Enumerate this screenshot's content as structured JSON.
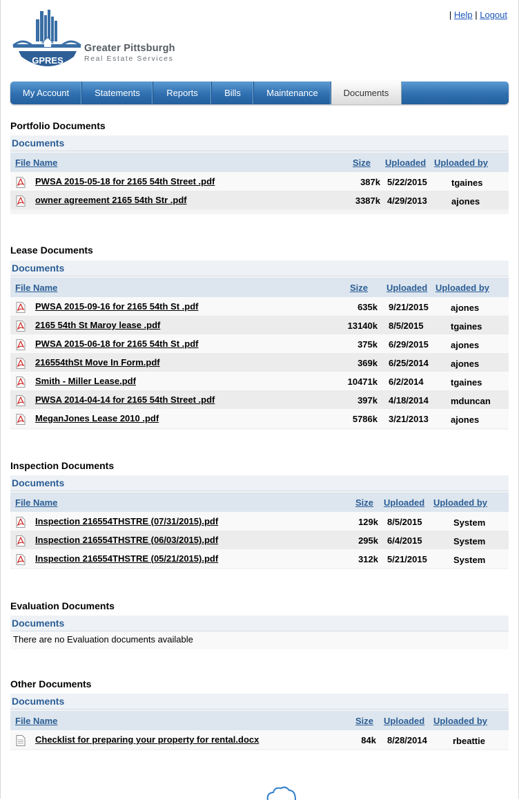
{
  "header": {
    "top_links": {
      "sep1": "|",
      "help": "Help",
      "sep2": "|",
      "logout": "Logout"
    },
    "logo": {
      "badge": "GPRES",
      "name": "Greater Pittsburgh",
      "tagline": "Real Estate Services"
    }
  },
  "nav": {
    "tabs": [
      {
        "label": "My Account",
        "active": false
      },
      {
        "label": "Statements",
        "active": false
      },
      {
        "label": "Reports",
        "active": false
      },
      {
        "label": "Bills",
        "active": false
      },
      {
        "label": "Maintenance",
        "active": false
      },
      {
        "label": "Documents",
        "active": true
      }
    ]
  },
  "columns": {
    "file_name": "File Name",
    "size": "Size",
    "uploaded": "Uploaded",
    "uploaded_by": "Uploaded by"
  },
  "sections": {
    "portfolio": {
      "title": "Portfolio Documents",
      "panel_title": "Documents",
      "files": [
        {
          "name": "PWSA 2015-05-18 for  2165 54th Street .pdf",
          "size": "387k",
          "uploaded": "5/22/2015",
          "by": "tgaines",
          "type": "pdf"
        },
        {
          "name": "owner agreement 2165 54th Str   .pdf",
          "size": "3387k",
          "uploaded": "4/29/2013",
          "by": "ajones",
          "type": "pdf"
        }
      ]
    },
    "lease": {
      "title": "Lease Documents",
      "panel_title": "Documents",
      "files": [
        {
          "name": "PWSA 2015-09-16 for  2165 54th St           .pdf",
          "size": "635k",
          "uploaded": "9/21/2015",
          "by": "ajones",
          "type": "pdf"
        },
        {
          "name": "2165 54th St Maroy lease .pdf",
          "size": "13140k",
          "uploaded": "8/5/2015",
          "by": "tgaines",
          "type": "pdf"
        },
        {
          "name": "PWSA 2015-06-18 for  2165 54th St           .pdf",
          "size": "375k",
          "uploaded": "6/29/2015",
          "by": "ajones",
          "type": "pdf"
        },
        {
          "name": "216554thSt Move In Form.pdf",
          "size": "369k",
          "uploaded": "6/25/2014",
          "by": "ajones",
          "type": "pdf"
        },
        {
          "name": "Smith - Miller Lease.pdf",
          "size": "10471k",
          "uploaded": "6/2/2014",
          "by": "tgaines",
          "type": "pdf"
        },
        {
          "name": "PWSA 2014-04-14 for  2165 54th Street .pdf",
          "size": "397k",
          "uploaded": "4/18/2014",
          "by": "mduncan",
          "type": "pdf"
        },
        {
          "name": "MeganJones Lease 2010 .pdf",
          "size": "5786k",
          "uploaded": "3/21/2013",
          "by": "ajones",
          "type": "pdf"
        }
      ]
    },
    "inspection": {
      "title": "Inspection Documents",
      "panel_title": "Documents",
      "files": [
        {
          "name": "Inspection  216554THSTRE (07/31/2015).pdf",
          "size": "129k",
          "uploaded": "8/5/2015",
          "by": "System",
          "type": "pdf"
        },
        {
          "name": "Inspection  216554THSTRE (06/03/2015).pdf",
          "size": "295k",
          "uploaded": "6/4/2015",
          "by": "System",
          "type": "pdf"
        },
        {
          "name": "Inspection  216554THSTRE (05/21/2015).pdf",
          "size": "312k",
          "uploaded": "5/21/2015",
          "by": "System",
          "type": "pdf"
        }
      ]
    },
    "evaluation": {
      "title": "Evaluation Documents",
      "panel_title": "Documents",
      "empty_message": "There are no Evaluation documents available"
    },
    "other": {
      "title": "Other Documents",
      "panel_title": "Documents",
      "files": [
        {
          "name": "Checklist for preparing your property for rental.docx",
          "size": "84k",
          "uploaded": "8/28/2014",
          "by": "rbeattie",
          "type": "doc"
        }
      ]
    }
  },
  "colors": {
    "nav_blue": "#2f6fb0",
    "panel_header_text": "#2b5d94",
    "link_blue": "#1a55b8",
    "pdf_red": "#c8221d"
  }
}
